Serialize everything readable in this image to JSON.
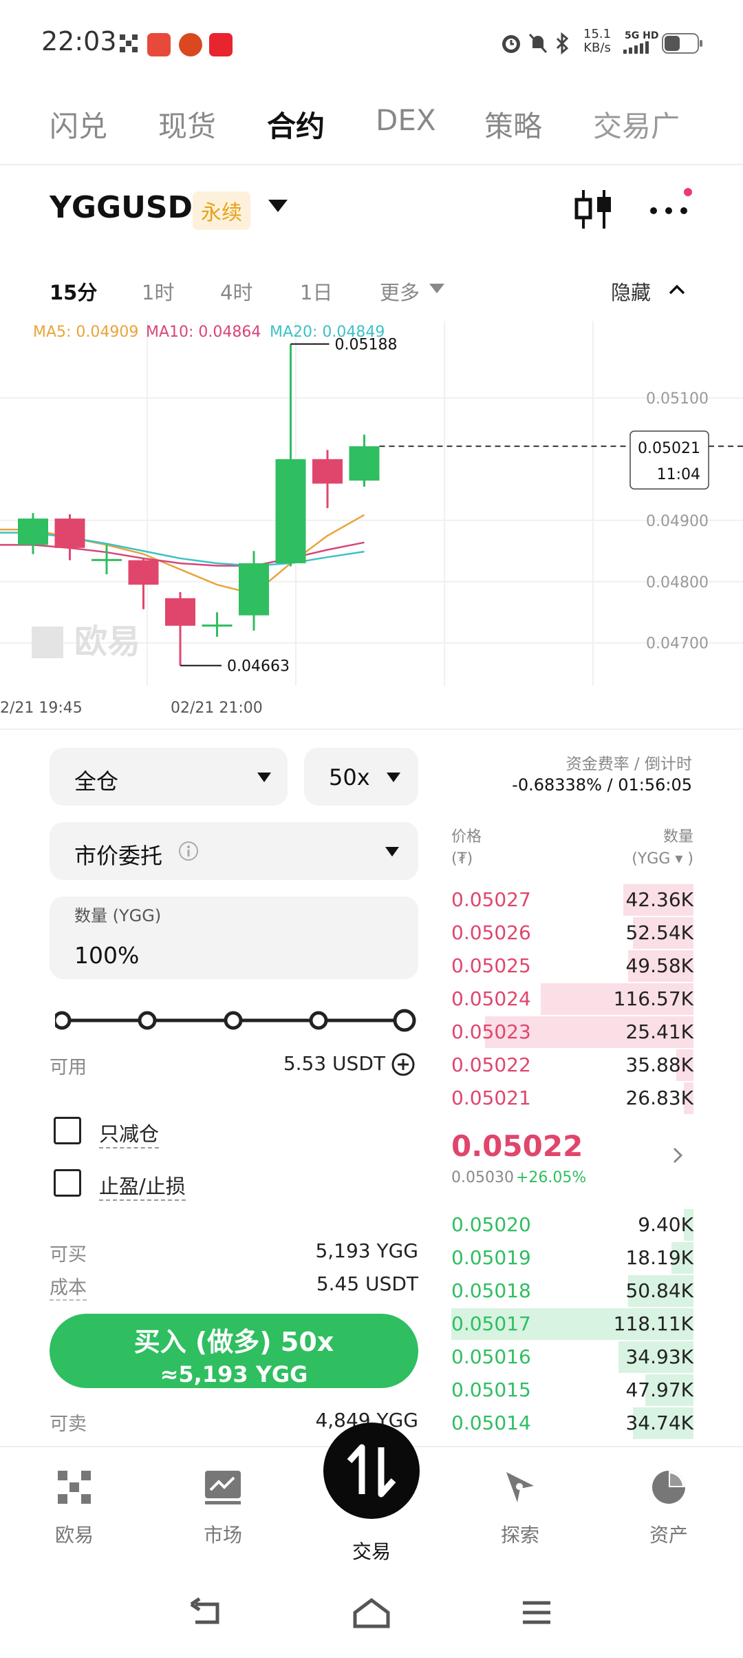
{
  "status_bar": {
    "time": "22:03",
    "net_speed_value": "15.1",
    "net_speed_unit": "KB/s",
    "network": "5G HD"
  },
  "top_tabs": [
    "闪兑",
    "现货",
    "合约",
    "DEX",
    "策略",
    "交易广"
  ],
  "instrument": {
    "pair": "YGGUSDT",
    "badge": "永续"
  },
  "timeframes": {
    "items": [
      "15分",
      "1时",
      "4时",
      "1日",
      "更多"
    ],
    "hide_label": "隐藏"
  },
  "chart_data": {
    "type": "candlestick",
    "ma_legend": {
      "ma5": "MA5: 0.04909",
      "ma10": "MA10: 0.04864",
      "ma20": "MA20: 0.04849"
    },
    "y_ticks": [
      "0.05100",
      "0.04900",
      "0.04800",
      "0.04700"
    ],
    "x_ticks": [
      "2/21 19:45",
      "02/21 21:00"
    ],
    "high_label": "0.05188",
    "low_label": "0.04663",
    "current_price": "0.05021",
    "countdown": "11:04",
    "watermark": "欧易",
    "ylim": [
      0.0463,
      0.0521
    ],
    "candles": [
      {
        "o": 0.0486,
        "c": 0.04903,
        "h": 0.04912,
        "l": 0.04845
      },
      {
        "o": 0.04903,
        "c": 0.04855,
        "h": 0.0491,
        "l": 0.04835
      },
      {
        "o": 0.04835,
        "c": 0.04837,
        "h": 0.0486,
        "l": 0.04812
      },
      {
        "o": 0.04835,
        "c": 0.04795,
        "h": 0.04838,
        "l": 0.04755
      },
      {
        "o": 0.04773,
        "c": 0.04728,
        "h": 0.04783,
        "l": 0.04663
      },
      {
        "o": 0.04728,
        "c": 0.0473,
        "h": 0.0475,
        "l": 0.0471
      },
      {
        "o": 0.04745,
        "c": 0.0483,
        "h": 0.0485,
        "l": 0.0472
      },
      {
        "o": 0.0483,
        "c": 0.05,
        "h": 0.05188,
        "l": 0.04825
      },
      {
        "o": 0.05,
        "c": 0.0496,
        "h": 0.05015,
        "l": 0.0492
      },
      {
        "o": 0.04965,
        "c": 0.05021,
        "h": 0.0504,
        "l": 0.04955
      }
    ],
    "ma_series": [
      {
        "name": "MA5",
        "color": "#e8a43a",
        "values": [
          0.04885,
          0.04872,
          0.0486,
          0.04845,
          0.0482,
          0.04795,
          0.0478,
          0.0483,
          0.04875,
          0.04909
        ]
      },
      {
        "name": "MA10",
        "color": "#d6457a",
        "values": [
          0.0486,
          0.04855,
          0.04848,
          0.04838,
          0.0483,
          0.04826,
          0.04826,
          0.04838,
          0.04852,
          0.04864
        ]
      },
      {
        "name": "MA20",
        "color": "#3cc0c8",
        "values": [
          0.0488,
          0.04872,
          0.04862,
          0.0485,
          0.04838,
          0.0483,
          0.04826,
          0.0483,
          0.0484,
          0.04849
        ]
      }
    ]
  },
  "order_form": {
    "margin_mode": "全仓",
    "leverage": "50x",
    "order_type": "市价委托",
    "qty_label": "数量 (YGG)",
    "qty_value": "100%",
    "slider_percent": 100,
    "available_label": "可用",
    "available_value": "5.53 USDT",
    "reduce_only": "只减仓",
    "tp_sl": "止盈/止损",
    "can_buy_label": "可买",
    "can_buy_value": "5,193 YGG",
    "cost_label": "成本",
    "cost_value": "5.45 USDT",
    "buy_button_line1": "买入 (做多) 50x",
    "buy_button_line2": "≈5,193 YGG",
    "can_sell_label": "可卖",
    "can_sell_value": "4,849 YGG"
  },
  "orderbook": {
    "funding_label": "资金费率 / 倒计时",
    "funding_value": "-0.68338% / 01:56:05",
    "price_header": "价格",
    "price_unit": "(₮)",
    "qty_header": "数量",
    "qty_unit": "(YGG ▾ )",
    "asks": [
      {
        "price": "0.05027",
        "qty": "42.36K",
        "depth": 0.29
      },
      {
        "price": "0.05026",
        "qty": "52.54K",
        "depth": 0.25
      },
      {
        "price": "0.05025",
        "qty": "49.58K",
        "depth": 0.27
      },
      {
        "price": "0.05024",
        "qty": "116.57K",
        "depth": 0.63
      },
      {
        "price": "0.05023",
        "qty": "25.41K",
        "depth": 0.86
      },
      {
        "price": "0.05022",
        "qty": "35.88K",
        "depth": 0.07
      },
      {
        "price": "0.05021",
        "qty": "26.83K",
        "depth": 0.04
      }
    ],
    "mid_price": "0.05022",
    "mark_price": "0.05030",
    "change": "+26.05%",
    "bids": [
      {
        "price": "0.05020",
        "qty": "9.40K",
        "depth": 0.04
      },
      {
        "price": "0.05019",
        "qty": "18.19K",
        "depth": 0.09
      },
      {
        "price": "0.05018",
        "qty": "50.84K",
        "depth": 0.27
      },
      {
        "price": "0.05017",
        "qty": "118.11K",
        "depth": 1.0
      },
      {
        "price": "0.05016",
        "qty": "34.93K",
        "depth": 0.31
      },
      {
        "price": "0.05015",
        "qty": "47.97K",
        "depth": 0.2
      },
      {
        "price": "0.05014",
        "qty": "34.74K",
        "depth": 0.25
      }
    ]
  },
  "bottom_nav": [
    "欧易",
    "市场",
    "交易",
    "探索",
    "资产"
  ],
  "colors": {
    "up": "#2fbe60",
    "down": "#e0466c",
    "ask_depth": "#fbdfe6",
    "bid_depth": "#d8f3e1"
  }
}
